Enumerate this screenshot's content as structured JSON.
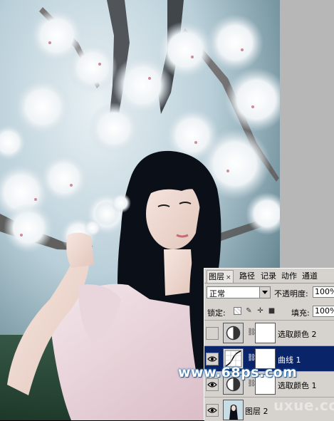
{
  "panel": {
    "tabs": [
      {
        "label": "图层",
        "active": true,
        "close": "×"
      },
      {
        "label": "路径",
        "active": false
      },
      {
        "label": "记录",
        "active": false
      },
      {
        "label": "动作",
        "active": false
      },
      {
        "label": "通道",
        "active": false
      }
    ],
    "blend_mode": "正常",
    "opacity_label": "不透明度:",
    "opacity_value": "100%",
    "lock_label": "锁定:",
    "fill_label": "填充:",
    "fill_value": "100%",
    "layers": [
      {
        "name": "选取颜色 2",
        "visible": false,
        "selected": false,
        "thumb_icon": "selective-color-icon"
      },
      {
        "name": "曲线 1",
        "visible": true,
        "selected": true,
        "thumb_icon": "curves-icon"
      },
      {
        "name": "选取颜色 1",
        "visible": true,
        "selected": false,
        "thumb_icon": "selective-color-icon"
      },
      {
        "name": "图层 2",
        "visible": true,
        "selected": false,
        "thumb_icon": "photo-thumbnail"
      }
    ]
  },
  "watermark": "www.68ps.com",
  "watermark_secondary": "uxue.com",
  "colors": {
    "panel_bg": "#d6d3ce",
    "selection": "#0a246a",
    "app_bg": "#b7b7b7"
  }
}
